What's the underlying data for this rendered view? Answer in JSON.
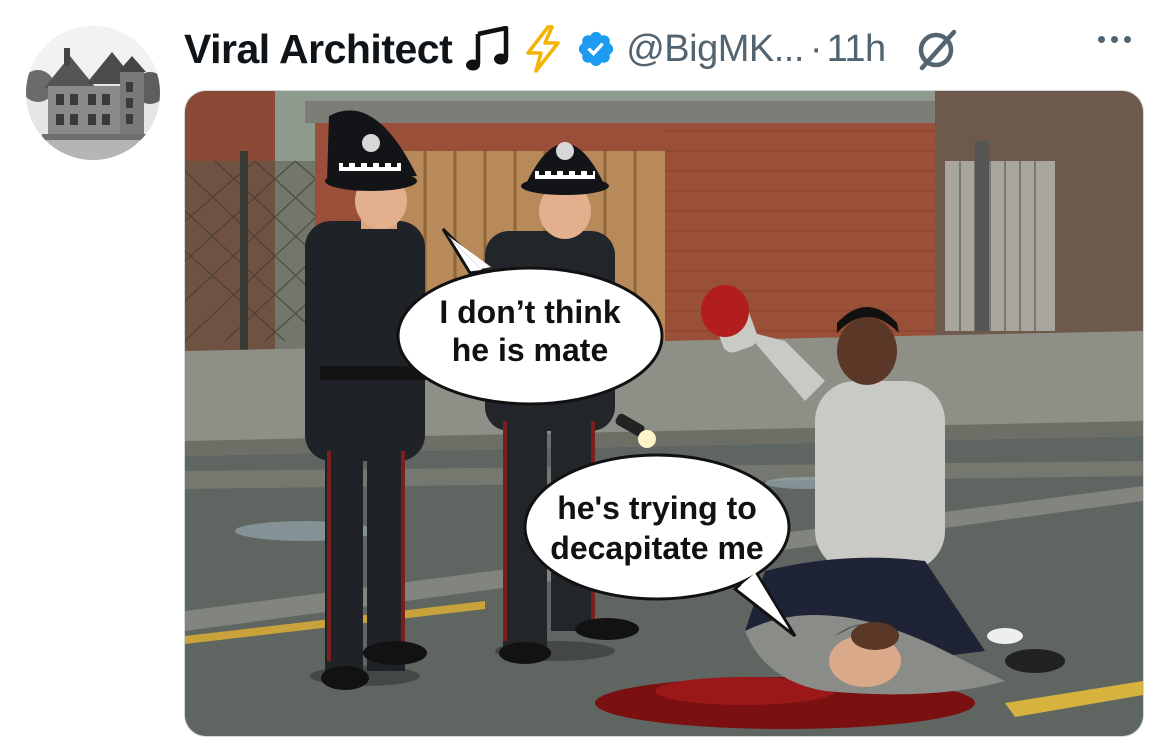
{
  "author": {
    "display_name": "Viral Architect",
    "emoji_1": "music-notes-emoji",
    "emoji_2": "lightning-emoji",
    "verified": true,
    "handle": "@BigMK...",
    "separator": "·",
    "time": "11h"
  },
  "icons": {
    "grok": "grok-slash-icon",
    "more": "more-options-icon"
  },
  "media": {
    "description_kind": "comic-meme",
    "bubble_1_line_1": "I don’t think",
    "bubble_1_line_2": "he is mate",
    "bubble_2_line_1": "he's trying to",
    "bubble_2_line_2": "decapitate me"
  },
  "colors": {
    "verified_blue": "#1d9bf0",
    "text_primary": "#0f1419",
    "text_secondary": "#536471",
    "lightning": "#f5b400"
  }
}
